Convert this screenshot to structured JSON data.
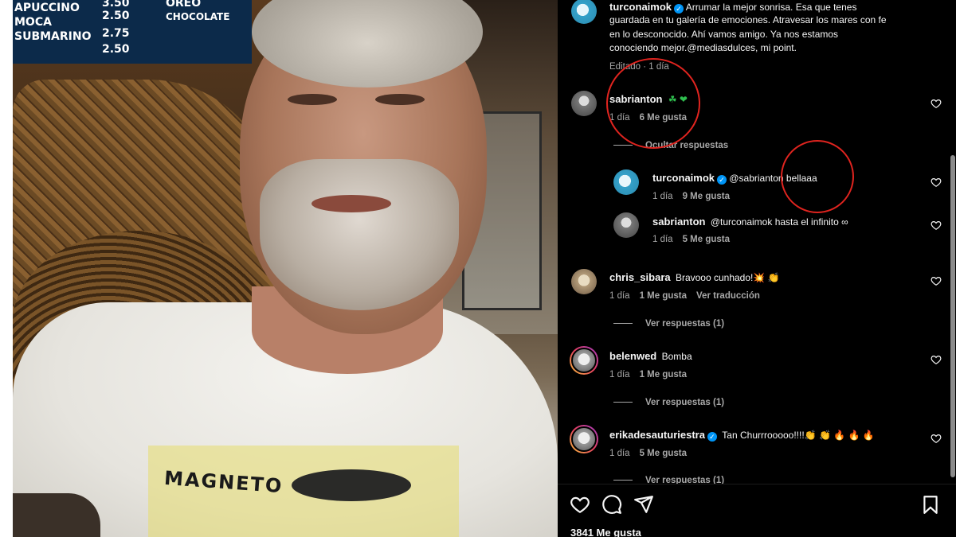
{
  "post": {
    "author": "turconaimok",
    "caption_lines": [
      "Arrumar la mejor sonrisa. Esa que tenes",
      "guardada en tu galería de emociones. Atravesar los mares con fe",
      "en lo desconocido. Ahí vamos amigo. Ya nos estamos",
      "conociendo mejor.@mediasdulces, mi point."
    ],
    "edited_meta": "Editado · 1 día",
    "likes": "3841 Me gusta"
  },
  "photo": {
    "shirt_text": "MAGNETO",
    "menu": [
      {
        "item": "APUCCINO",
        "price": "3.50"
      },
      {
        "item": "MOCA",
        "price": "2.50"
      },
      {
        "item": "SUBMARINO",
        "price": "2.75"
      },
      {
        "item": "",
        "price": "2.50"
      }
    ],
    "menu_right": [
      "OREO",
      "CHOCOLATE"
    ]
  },
  "comments": [
    {
      "user": "sabrianton",
      "text": "☘ ❤",
      "time": "1 día",
      "likes": "6 Me gusta",
      "hide_replies": "Ocultar respuestas"
    },
    {
      "user": "turconaimok",
      "text": "@sabrianton bellaaa",
      "time": "1 día",
      "likes": "9 Me gusta"
    },
    {
      "user": "sabrianton",
      "text": "@turconaimok hasta el infinito ∞",
      "time": "1 día",
      "likes": "5 Me gusta"
    },
    {
      "user": "chris_sibara",
      "text": "Bravooo cunhado!💥 👏",
      "time": "1 día",
      "likes": "1 Me gusta",
      "translate": "Ver traducción",
      "view_replies": "Ver respuestas (1)"
    },
    {
      "user": "belenwed",
      "text": "Bomba",
      "time": "1 día",
      "likes": "1 Me gusta",
      "view_replies": "Ver respuestas (1)"
    },
    {
      "user": "erikadesauturiestra",
      "text": "Tan Churrrooooo!!!!👏 👏 🔥 🔥 🔥",
      "time": "1 día",
      "likes": "5 Me gusta",
      "view_replies": "Ver respuestas (1)"
    }
  ],
  "icons": {
    "like": "heart-icon",
    "comment": "comment-icon",
    "share": "share-icon",
    "save": "bookmark-icon"
  },
  "colors": {
    "background": "#000000",
    "secondary_text": "#a8a8a8",
    "verified": "#0095f6",
    "annotation": "#e0241f"
  }
}
